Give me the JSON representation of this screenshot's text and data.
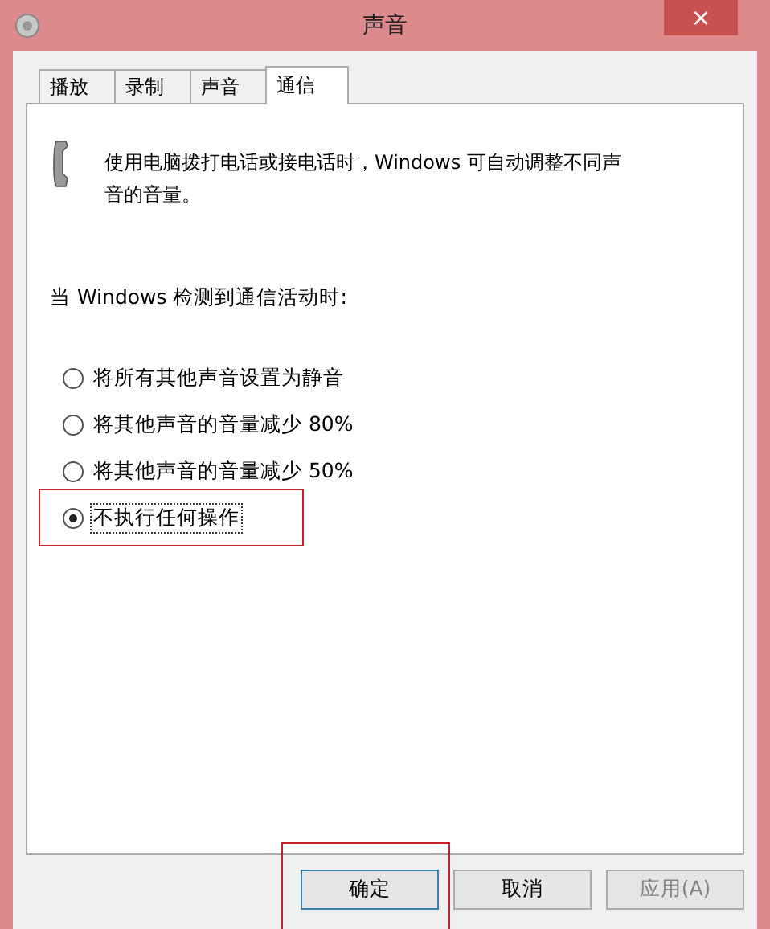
{
  "window": {
    "title": "声音",
    "close": "×"
  },
  "tabs": [
    {
      "label": "播放",
      "selected": false
    },
    {
      "label": "录制",
      "selected": false
    },
    {
      "label": "声音",
      "selected": false
    },
    {
      "label": "通信",
      "selected": true
    }
  ],
  "description": "使用电脑拨打电话或接电话时，Windows 可自动调整不同声音的音量。",
  "prompt": "当 Windows 检测到通信活动时:",
  "options": [
    {
      "label": "将所有其他声音设置为静音",
      "selected": false,
      "highlighted": false
    },
    {
      "label": "将其他声音的音量减少 80%",
      "selected": false,
      "highlighted": false
    },
    {
      "label": "将其他声音的音量减少 50%",
      "selected": false,
      "highlighted": false
    },
    {
      "label": "不执行任何操作",
      "selected": true,
      "highlighted": true
    }
  ],
  "buttons": [
    {
      "label": "确定",
      "default": true,
      "disabled": false,
      "highlighted": true
    },
    {
      "label": "取消",
      "default": false,
      "disabled": false,
      "highlighted": false
    },
    {
      "label": "应用(A)",
      "default": false,
      "disabled": true,
      "highlighted": false
    }
  ]
}
